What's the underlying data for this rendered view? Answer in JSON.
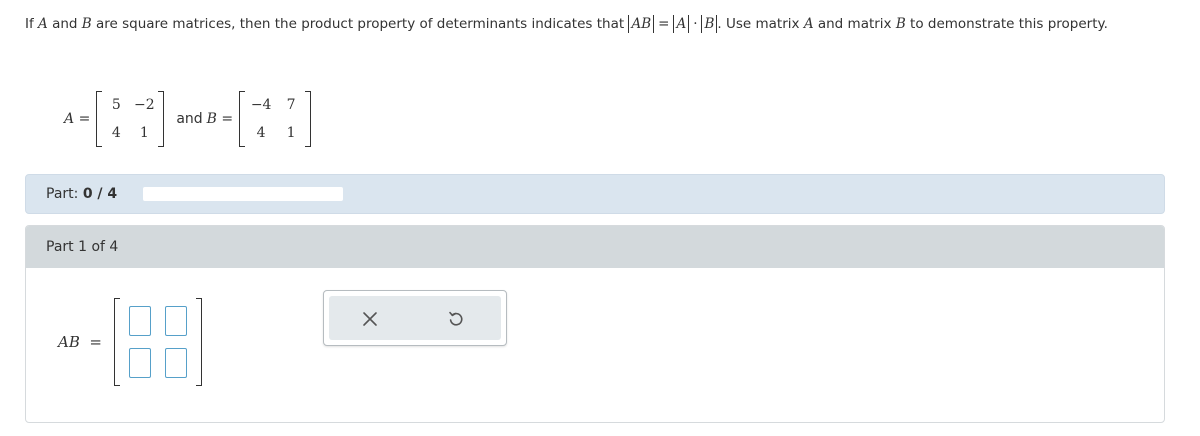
{
  "problem": {
    "t1": "If ",
    "A": "A",
    "t2": " and ",
    "B": "B",
    "t3": " are square matrices, then the product property of determinants indicates that ",
    "AB": "AB",
    "eq": "=",
    "dot": "·",
    "t4": ". Use matrix ",
    "t5": " and matrix ",
    "t6": " to demonstrate this property."
  },
  "matrices": {
    "a_label": "A",
    "a_eq": "=",
    "a": [
      [
        "5",
        "−2"
      ],
      [
        "4",
        "1"
      ]
    ],
    "and": "and",
    "b_label": "B",
    "b_eq": "=",
    "b": [
      [
        "−4",
        "7"
      ],
      [
        "4",
        "1"
      ]
    ]
  },
  "progress": {
    "label": "Part:",
    "value": "0 / 4",
    "fraction": 0
  },
  "part": {
    "header": "Part 1 of 4",
    "answer_label": "AB",
    "answer_eq": "=",
    "inputs": [
      [
        "",
        ""
      ],
      [
        "",
        ""
      ]
    ]
  },
  "tools": {
    "clear_icon": "close-icon",
    "undo_icon": "undo-icon"
  },
  "colors": {
    "progress_bg": "#dae5ef",
    "part_header_bg": "#d3d9dc",
    "input_border": "#56a0c9",
    "tool_bg": "#e4e9ec"
  }
}
